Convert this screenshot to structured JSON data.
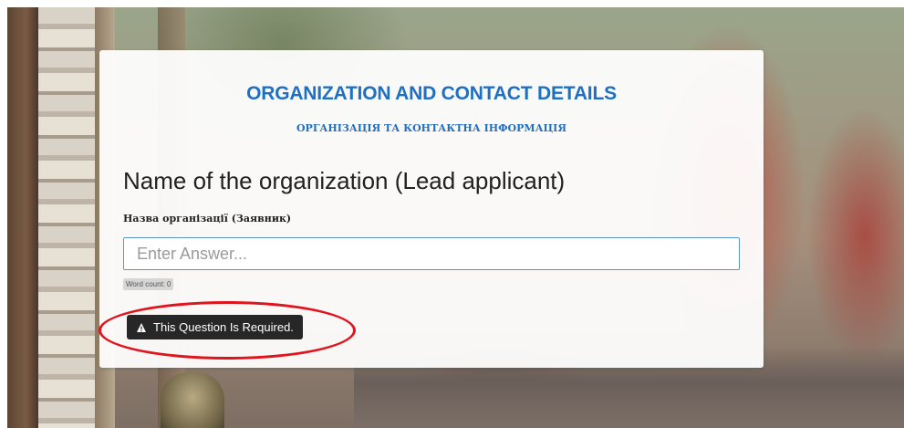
{
  "form": {
    "title": "ORGANIZATION AND CONTACT DETAILS",
    "subtitle": "ОРГАНІЗАЦІЯ ТА КОНТАКТНА ІНФОРМАЦІЯ",
    "question": {
      "label": "Name of the organization (Lead applicant)",
      "label_ua": "Назва організації (Заявник)",
      "answer_value": "",
      "answer_placeholder": "Enter Answer...",
      "word_count_label": "Word count:",
      "word_count_value": "0"
    },
    "validation": {
      "message": "This Question Is Required.",
      "icon": "warning-icon"
    }
  },
  "annotation": {
    "color": "#e0141c"
  },
  "colors": {
    "title": "#1f6fc2",
    "input_border": "#5b95c9",
    "error_bg": "#272727"
  }
}
